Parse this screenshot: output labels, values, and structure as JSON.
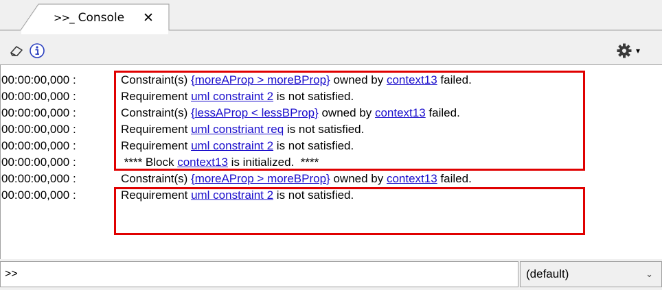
{
  "tab": {
    "prompt_icon": ">>_",
    "title": "Console",
    "close_glyph": "✕"
  },
  "toolbar": {
    "clear_icon": "eraser-icon",
    "info_icon": "info-icon",
    "settings_icon": "gear-icon",
    "menu_chevron": "▾"
  },
  "log": [
    {
      "ts": "00:00:00,000 :",
      "parts": [
        {
          "t": "Constraint(s) "
        },
        {
          "t": "{moreAProp > moreBProp}",
          "link": true
        },
        {
          "t": " owned by "
        },
        {
          "t": "context13",
          "link": true
        },
        {
          "t": " failed."
        }
      ]
    },
    {
      "ts": "00:00:00,000 :",
      "parts": [
        {
          "t": "Requirement "
        },
        {
          "t": "uml constraint 2",
          "link": true
        },
        {
          "t": " is not satisfied."
        }
      ]
    },
    {
      "ts": "00:00:00,000 :",
      "parts": [
        {
          "t": "Constraint(s) "
        },
        {
          "t": "{lessAProp < lessBProp}",
          "link": true
        },
        {
          "t": " owned by "
        },
        {
          "t": "context13",
          "link": true
        },
        {
          "t": " failed."
        }
      ]
    },
    {
      "ts": "00:00:00,000 :",
      "parts": [
        {
          "t": "Requirement "
        },
        {
          "t": "uml constriant req",
          "link": true
        },
        {
          "t": " is not satisfied."
        }
      ]
    },
    {
      "ts": "00:00:00,000 :",
      "parts": [
        {
          "t": "Requirement "
        },
        {
          "t": "uml constraint 2",
          "link": true
        },
        {
          "t": " is not satisfied."
        }
      ]
    },
    {
      "ts": "00:00:00,000 :",
      "parts": [
        {
          "t": " **** Block "
        },
        {
          "t": "context13",
          "link": true
        },
        {
          "t": " is initialized.  ****"
        }
      ]
    },
    {
      "ts": "00:00:00,000 :",
      "parts": [
        {
          "t": "Constraint(s) "
        },
        {
          "t": "{moreAProp > moreBProp}",
          "link": true
        },
        {
          "t": " owned by "
        },
        {
          "t": "context13",
          "link": true
        },
        {
          "t": " failed."
        }
      ]
    },
    {
      "ts": "00:00:00,000 :",
      "parts": [
        {
          "t": "Requirement "
        },
        {
          "t": "uml constraint 2",
          "link": true
        },
        {
          "t": " is not satisfied."
        }
      ]
    }
  ],
  "highlight_color": "#e00000",
  "link_color": "#1a0dcc",
  "command": {
    "prompt": ">>",
    "mode": "(default)",
    "mode_chevron": "⌄"
  }
}
